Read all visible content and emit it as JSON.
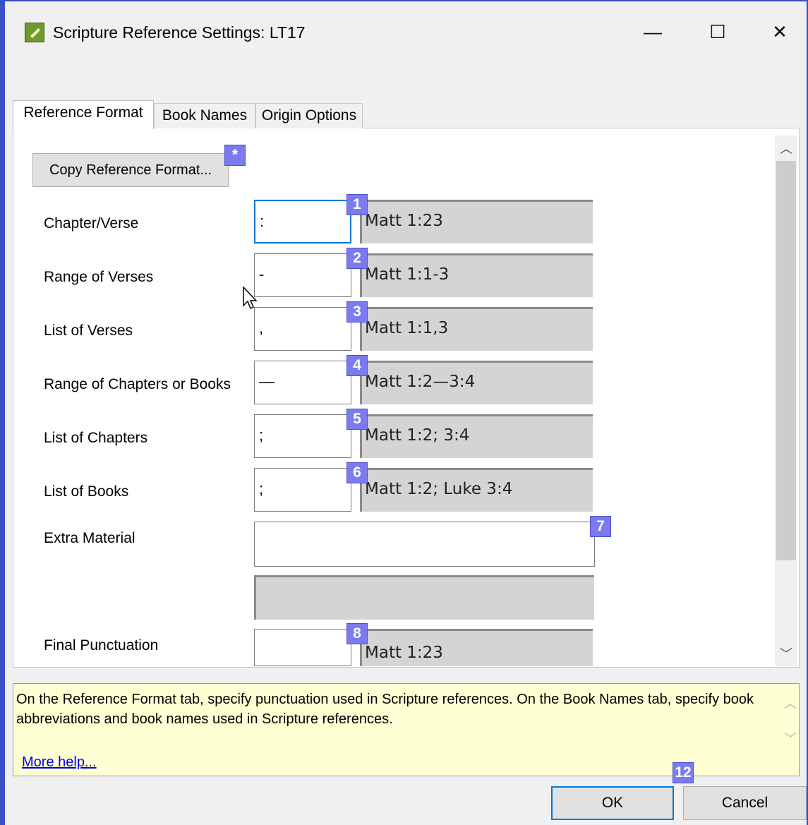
{
  "window": {
    "title": "Scripture Reference Settings: LT17",
    "minimize_glyph": "—",
    "maximize_glyph": "☐",
    "close_glyph": "✕",
    "app_icon": "paratext-app-icon"
  },
  "tabs": [
    {
      "label": "Reference Format",
      "active": true
    },
    {
      "label": "Book Names",
      "active": false
    },
    {
      "label": "Origin Options",
      "active": false
    }
  ],
  "copy_button": {
    "label": "Copy Reference Format...",
    "badge": "*"
  },
  "rows": [
    {
      "label": "Chapter/Verse",
      "separator": ":",
      "preview": "Matt 1:23",
      "badge": "1"
    },
    {
      "label": "Range of Verses",
      "separator": "-",
      "preview": "Matt 1:1-3",
      "badge": "2"
    },
    {
      "label": "List of Verses",
      "separator": ",",
      "preview": "Matt 1:1,3",
      "badge": "3"
    },
    {
      "label": "Range of Chapters or Books",
      "separator": "—",
      "preview": "Matt 1:2—3:4",
      "badge": "4"
    },
    {
      "label": "List of Chapters",
      "separator": ";",
      "preview": "Matt 1:2; 3:4",
      "badge": "5"
    },
    {
      "label": "List of Books",
      "separator": ";",
      "preview": "Matt 1:2; Luke 3:4",
      "badge": "6"
    }
  ],
  "extra_material": {
    "label": "Extra Material",
    "value": "",
    "badge": "7"
  },
  "final_punctuation": {
    "label": "Final Punctuation",
    "value": "",
    "preview": "Matt 1:23",
    "badge": "8"
  },
  "help": {
    "text": "On the Reference Format tab, specify punctuation used in Scripture references. On the Book Names tab, specify book abbreviations and book names used in Scripture references.",
    "link": "More help..."
  },
  "buttons": {
    "ok": "OK",
    "cancel": "Cancel",
    "ok_badge": "12"
  },
  "colors": {
    "accent": "#0078d7",
    "badge": "#7b7bf0",
    "help_bg": "#ffffd4",
    "frame": "#3c4fc8"
  }
}
